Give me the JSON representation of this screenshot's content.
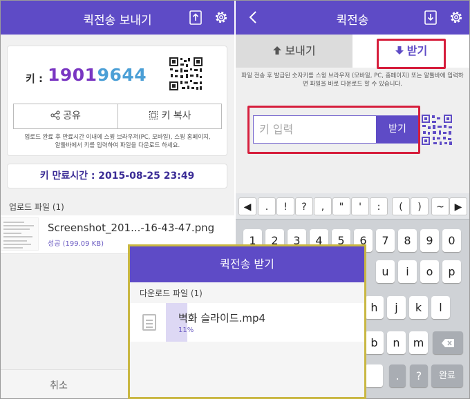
{
  "send": {
    "title": "퀵전송 보내기",
    "key_label": "키 :",
    "key_part1": "1901",
    "key_part2": "9644",
    "share_label": "공유",
    "copy_label": "키 복사",
    "notice": "업로드 완료 후 만료시간 이내에 스윙 브라우저(PC, 모바일), 스윙 홈페이지, 알툴바에서 키를 입력하여 파일을 다운로드 하세요.",
    "expiry": "키 만료시간 : 2015-08-25 23:49",
    "upload_section": "업로드 파일 (1)",
    "file_name": "Screenshot_201...-16-43-47.png",
    "file_status": "성공 (199.09 KB)",
    "cancel_label": "취소"
  },
  "receive": {
    "title": "퀵전송",
    "tab_send": "보내기",
    "tab_receive": "받기",
    "notice": "파일 전송 후 발급된 숫자키를 스윙 브라우저 (모바일, PC, 홈페이지) 또는 알툴바에 입력하면 파일을 바로 다운로드 할 수 있습니다.",
    "key_placeholder": "키 입력",
    "receive_button": "받기"
  },
  "keyboard": {
    "symbols": [
      ".",
      "!",
      "?",
      ",",
      "\"",
      "'",
      ":",
      "(",
      ")",
      "~"
    ],
    "numbers": [
      "1",
      "2",
      "3",
      "4",
      "5",
      "6",
      "7",
      "8",
      "9",
      "0"
    ],
    "row_keys": [
      "u",
      "i",
      "o",
      "p"
    ],
    "row2_keys": [
      "h",
      "j",
      "k",
      "l"
    ],
    "row3_keys": [
      "b",
      "n",
      "m"
    ],
    "period": ".",
    "question": "?",
    "done_label": "완료"
  },
  "dialog": {
    "title": "퀵전송 받기",
    "section": "다운로드 파일 (1)",
    "file_name": "벽화 슬라이드.mp4",
    "progress_text": "11%",
    "progress": 0.11
  },
  "colors": {
    "brand": "#5e4bc6",
    "highlight": "#d61e3c",
    "dialog_border": "#c9b742"
  }
}
